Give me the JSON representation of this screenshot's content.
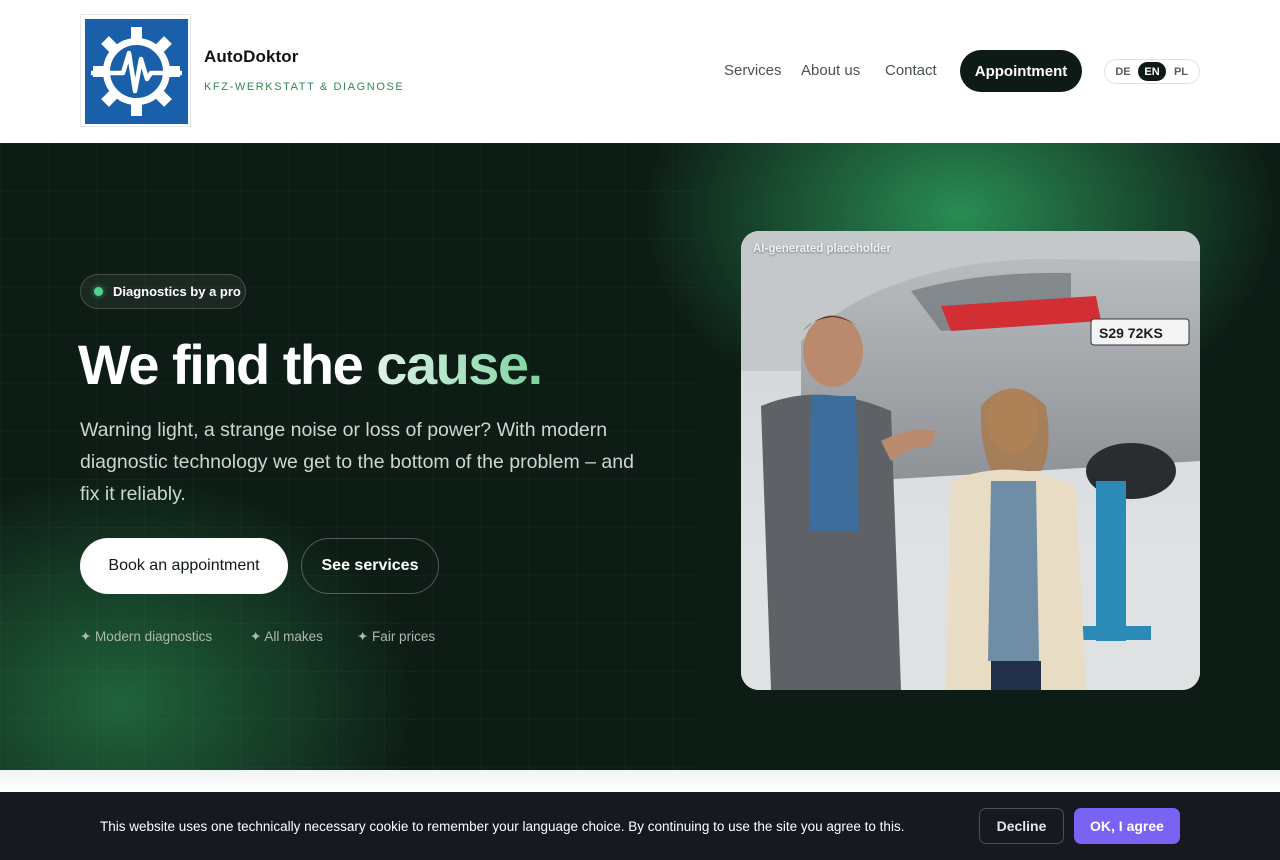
{
  "header": {
    "brand_name": "AutoDoktor",
    "brand_tagline": "KFZ-WERKSTATT & DIAGNOSE",
    "nav": {
      "services": "Services",
      "about": "About us",
      "contact": "Contact"
    },
    "appointment_label": "Appointment",
    "languages": [
      "DE",
      "EN",
      "PL"
    ],
    "active_language": "EN"
  },
  "hero": {
    "badge": "Diagnostics by a pro",
    "headline_start": "We find the ",
    "headline_accent": "cause.",
    "lead": "Warning light, a strange noise or loss of power? With modern diagnostic technology we get to the bottom of the problem – and fix it reliably.",
    "primary_cta": "Book an appointment",
    "secondary_cta": "See services",
    "features": [
      "✦ Modern diagnostics",
      "✦ All makes",
      "✦ Fair prices"
    ],
    "image_label": "AI-generated placeholder",
    "license_plate": "S29 72KS"
  },
  "cookie": {
    "text": "This website uses one technically necessary cookie to remember your language choice. By continuing to use the site you agree to this.",
    "decline_label": "Decline",
    "agree_label": "OK, I agree"
  },
  "colors": {
    "hero_bg": "#0d1c15",
    "accent_green": "#2f8a55",
    "cta_dark": "#0e1a14",
    "cookie_bg": "#161920",
    "agree_purple": "#7a63f2",
    "logo_blue": "#1a5faa"
  }
}
